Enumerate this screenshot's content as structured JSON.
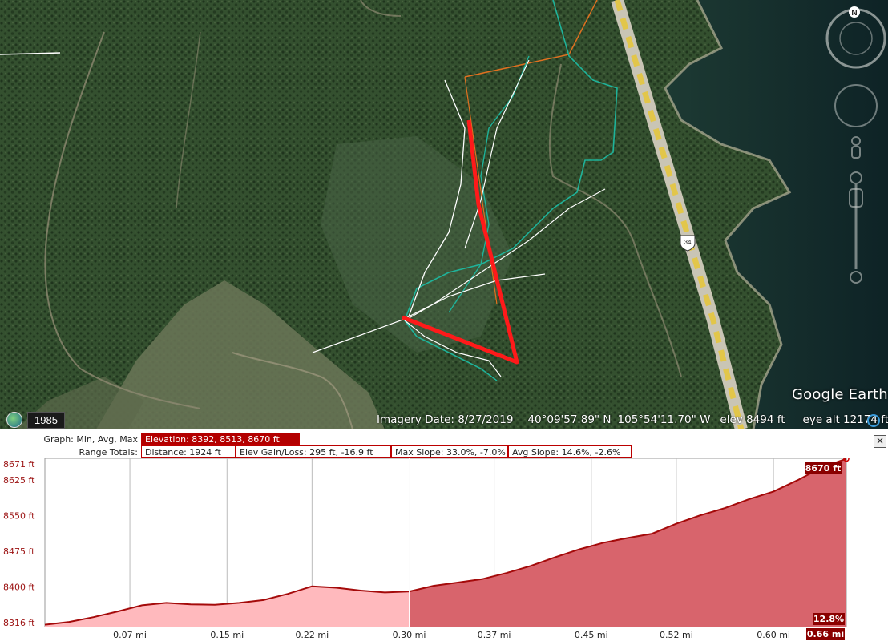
{
  "map": {
    "imagery_date": "Imagery Date: 8/27/2019",
    "latitude": "40°09'57.89\" N",
    "longitude": "105°54'11.70\" W",
    "elev": "elev  8494 ft",
    "eye_alt": "eye alt  12174 ft",
    "year": "1985",
    "logo": "Google Earth",
    "compass_letter": "N",
    "highway_label": "34",
    "colors": {
      "path": "#ff1a1a",
      "teal_track": "#1fb39a",
      "white_track": "#ffffff",
      "orange_track": "#e07020"
    }
  },
  "elevation_panel": {
    "graph_label": "Graph: Min, Avg, Max",
    "elevation_stats": "Elevation: 8392, 8513, 8670 ft",
    "range_label": "Range Totals:",
    "distance": "Distance: 1924 ft",
    "elev_gain_loss": "Elev Gain/Loss: 295 ft, -16.9 ft",
    "max_slope": "Max Slope: 33.0%, -7.0%",
    "avg_slope": "Avg Slope: 14.6%, -2.6%",
    "close_label": "×",
    "colors": {
      "fill_light": "#ffb9bd",
      "fill_dark": "#d8646c",
      "line": "#a40a0a",
      "badge": "#8a0000"
    }
  },
  "chart_data": {
    "type": "area",
    "title": "",
    "xlabel": "",
    "ylabel": "",
    "y_ticks": [
      "8671 ft",
      "8625 ft",
      "8550 ft",
      "8475 ft",
      "8400 ft",
      "8316 ft"
    ],
    "x_ticks": [
      "0.07 mi",
      "0.15 mi",
      "0.22 mi",
      "0.30 mi",
      "0.37 mi",
      "0.45 mi",
      "0.52 mi",
      "0.60 mi"
    ],
    "x_tick_values": [
      0.07,
      0.15,
      0.22,
      0.3,
      0.37,
      0.45,
      0.52,
      0.6
    ],
    "ylim": [
      8316,
      8671
    ],
    "xlim": [
      0,
      0.66
    ],
    "selection_start": 0.3,
    "grid": true,
    "series": [
      {
        "x": [
          0,
          0.02,
          0.04,
          0.06,
          0.08,
          0.1,
          0.12,
          0.14,
          0.16,
          0.18,
          0.2,
          0.22,
          0.24,
          0.26,
          0.28,
          0.3,
          0.32,
          0.34,
          0.36,
          0.38,
          0.4,
          0.42,
          0.44,
          0.46,
          0.48,
          0.5,
          0.52,
          0.54,
          0.56,
          0.58,
          0.6,
          0.62,
          0.64,
          0.66
        ],
        "y": [
          8320,
          8326,
          8336,
          8348,
          8361,
          8366,
          8363,
          8362,
          8366,
          8372,
          8385,
          8401,
          8398,
          8392,
          8388,
          8390,
          8402,
          8409,
          8416,
          8429,
          8444,
          8462,
          8479,
          8493,
          8503,
          8512,
          8533,
          8551,
          8566,
          8585,
          8601,
          8625,
          8652,
          8670
        ]
      }
    ],
    "data_labels": {
      "max_label": "8670 ft",
      "slope_label": "12.8%",
      "distance_label": "0.66 mi"
    }
  }
}
